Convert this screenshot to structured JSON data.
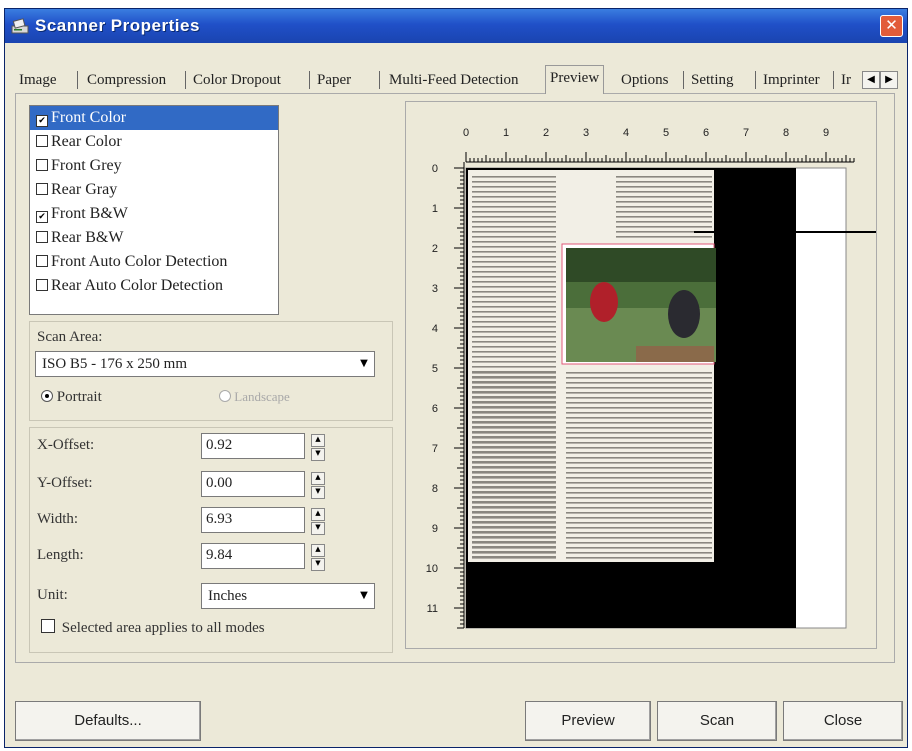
{
  "window": {
    "title": "Scanner Properties"
  },
  "tabs": [
    "Image",
    "Compression",
    "Color Dropout",
    "Paper",
    "Multi-Feed Detection",
    "Preview",
    "Options",
    "Setting",
    "Imprinter",
    "Ir"
  ],
  "active_tab": "Preview",
  "image_types": [
    {
      "label": "Front Color",
      "checked": true,
      "selected": true
    },
    {
      "label": "Rear Color",
      "checked": false,
      "selected": false
    },
    {
      "label": "Front Grey",
      "checked": false,
      "selected": false
    },
    {
      "label": "Rear Gray",
      "checked": false,
      "selected": false
    },
    {
      "label": "Front B&W",
      "checked": true,
      "selected": false
    },
    {
      "label": "Rear B&W",
      "checked": false,
      "selected": false
    },
    {
      "label": "Front Auto Color Detection",
      "checked": false,
      "selected": false
    },
    {
      "label": "Rear Auto Color Detection",
      "checked": false,
      "selected": false
    }
  ],
  "scan_area": {
    "label": "Scan Area:",
    "value": "ISO B5 - 176 x 250 mm",
    "portrait_label": "Portrait",
    "landscape_label": "Landscape",
    "orientation": "Portrait"
  },
  "offsets": {
    "x_label": "X-Offset:",
    "x_value": "0.92",
    "y_label": "Y-Offset:",
    "y_value": "0.00",
    "width_label": "Width:",
    "width_value": "6.93",
    "length_label": "Length:",
    "length_value": "9.84",
    "unit_label": "Unit:",
    "unit_value": "Inches",
    "apply_all_label": "Selected area applies to all modes",
    "apply_all_checked": false
  },
  "ruler": {
    "x_labels": [
      "0",
      "1",
      "2",
      "3",
      "4",
      "5",
      "6",
      "7",
      "8",
      "9"
    ],
    "y_labels": [
      "0",
      "1",
      "2",
      "3",
      "4",
      "5",
      "6",
      "7",
      "8",
      "9",
      "10",
      "11"
    ]
  },
  "buttons": {
    "defaults": "Defaults...",
    "preview": "Preview",
    "scan": "Scan",
    "close": "Close"
  },
  "colors": {
    "titlebar": "#2050c8",
    "selection": "#316ac5",
    "close": "#e25c3a",
    "dialog_bg": "#ece9d8"
  }
}
